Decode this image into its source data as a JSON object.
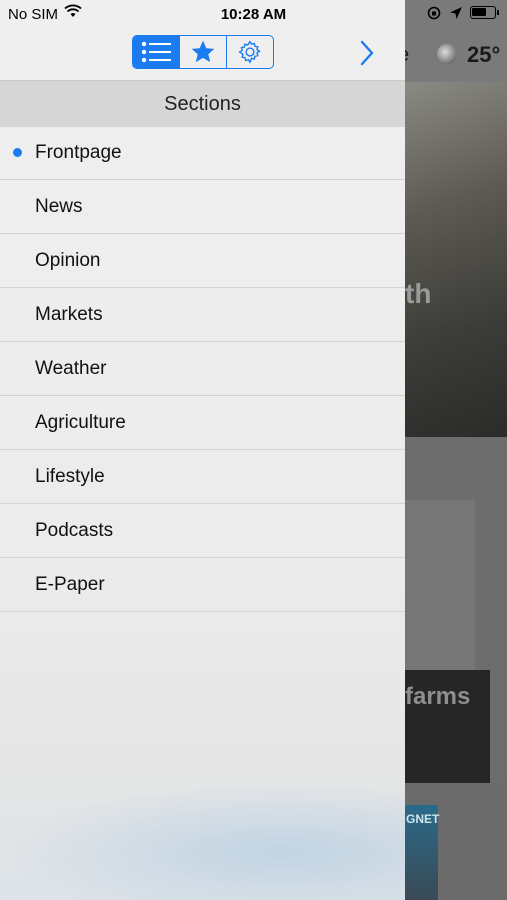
{
  "status_bar": {
    "carrier": "No SIM",
    "time": "10:28 AM"
  },
  "background": {
    "header_fragment": "e",
    "temperature": "25°",
    "photo_text": "th",
    "card_text": "farms",
    "magazine_text": "GNET"
  },
  "toolbar": {
    "tabs": [
      {
        "icon": "list-icon",
        "active": true
      },
      {
        "icon": "star-icon",
        "active": false
      },
      {
        "icon": "gear-icon",
        "active": false
      }
    ],
    "accent_color": "#1a7cf0"
  },
  "sections": {
    "title": "Sections",
    "items": [
      {
        "label": "Frontpage",
        "selected": true
      },
      {
        "label": "News",
        "selected": false
      },
      {
        "label": "Opinion",
        "selected": false
      },
      {
        "label": "Markets",
        "selected": false
      },
      {
        "label": "Weather",
        "selected": false
      },
      {
        "label": "Agriculture",
        "selected": false
      },
      {
        "label": "Lifestyle",
        "selected": false
      },
      {
        "label": "Podcasts",
        "selected": false
      },
      {
        "label": "E-Paper",
        "selected": false
      }
    ]
  }
}
